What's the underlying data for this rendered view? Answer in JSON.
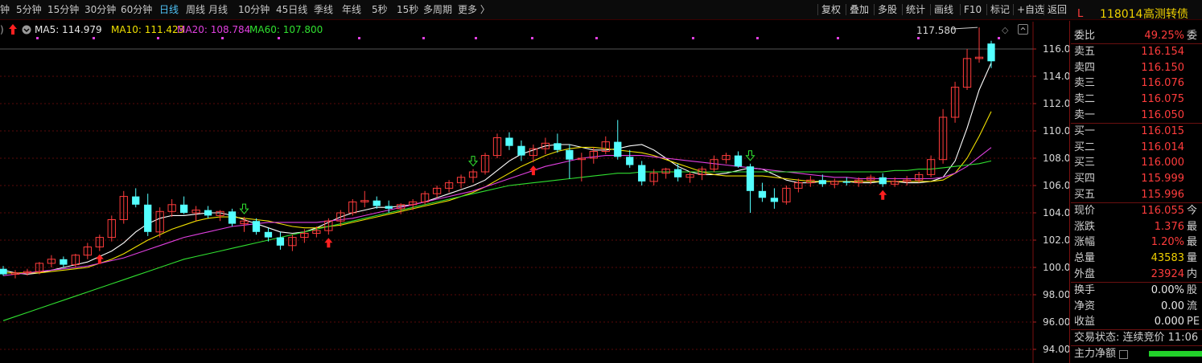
{
  "toolbar": {
    "timeframes": [
      "钟",
      "5分钟",
      "15分钟",
      "30分钟",
      "60分钟",
      "日线",
      "周线",
      "月线",
      "10分钟",
      "45日线",
      "季线",
      "年线",
      "5秒",
      "15秒",
      "多周期",
      "更多 〉"
    ],
    "active_timeframe": "日线",
    "right_buttons": [
      "复权",
      "叠加",
      "多股",
      "统计",
      "画线",
      "F10",
      "标记",
      "+自选",
      "返回"
    ]
  },
  "quote_header": {
    "market_flag": "L",
    "code": "118014",
    "name": "高测转债"
  },
  "ma_legend": {
    "prefix": ")",
    "ma5": "MA5: 114.979",
    "ma10": "MA10: 111.423",
    "ma20": "MA20: 108.784",
    "ma60": "MA60: 107.800"
  },
  "chart": {
    "y_axis": {
      "min": 93,
      "max": 118,
      "ticks": [
        "116.0",
        "114.0",
        "112.0",
        "110.0",
        "108.0",
        "106.0",
        "104.0",
        "102.0",
        "100.0",
        "98.00",
        "96.00",
        "94.00"
      ],
      "tick_values": [
        116,
        114,
        112,
        110,
        108,
        106,
        104,
        102,
        100,
        98,
        96,
        94
      ]
    },
    "crosshair_value": 116.0,
    "peak_label": "117.580",
    "colors": {
      "up": "#ff3c3c",
      "down": "#54ffff",
      "ma5": "#ffffff",
      "ma10": "#f0e000",
      "ma20": "#e040e0",
      "ma60": "#30e030",
      "grid": "#5a0a0a"
    }
  },
  "chart_data": {
    "type": "candlestick",
    "y_range": [
      93,
      118
    ],
    "series": [
      {
        "name": "MA5",
        "values": [
          99.8,
          99.6,
          99.5,
          99.6,
          99.8,
          100.0,
          100.2,
          100.4,
          100.8,
          101.2,
          101.8,
          102.6,
          103.2,
          103.6,
          103.8,
          103.8,
          103.9,
          104.0,
          104.0,
          103.8,
          103.5,
          103.2,
          102.9,
          102.6,
          102.5,
          102.6,
          102.9,
          103.3,
          103.7,
          104.0,
          104.2,
          104.4,
          104.4,
          104.5,
          104.6,
          104.8,
          105.1,
          105.4,
          105.7,
          106.0,
          106.4,
          107.1,
          107.8,
          108.3,
          108.6,
          108.9,
          109.0,
          109.0,
          108.8,
          108.6,
          108.6,
          108.7,
          108.9,
          109.0,
          108.6,
          108.0,
          107.4,
          107.0,
          106.8,
          106.8,
          106.9,
          107.1,
          107.3,
          107.2,
          106.8,
          106.4,
          106.2,
          106.2,
          106.3,
          106.3,
          106.3,
          106.2,
          106.2,
          106.3,
          106.3,
          106.2,
          106.2,
          106.3,
          106.6,
          107.8,
          110.2,
          113.0,
          114.98
        ]
      },
      {
        "name": "MA10",
        "values": [
          99.6,
          99.6,
          99.6,
          99.6,
          99.7,
          99.8,
          99.9,
          100.0,
          100.3,
          100.6,
          101.0,
          101.5,
          102.0,
          102.4,
          102.8,
          103.1,
          103.4,
          103.6,
          103.7,
          103.7,
          103.6,
          103.5,
          103.4,
          103.2,
          103.0,
          102.9,
          102.9,
          103.0,
          103.1,
          103.3,
          103.5,
          103.7,
          103.9,
          104.1,
          104.3,
          104.5,
          104.7,
          104.9,
          105.2,
          105.5,
          105.9,
          106.4,
          106.9,
          107.4,
          107.8,
          108.2,
          108.5,
          108.7,
          108.8,
          108.8,
          108.7,
          108.6,
          108.5,
          108.4,
          108.2,
          107.9,
          107.6,
          107.3,
          107.0,
          106.8,
          106.7,
          106.7,
          106.7,
          106.7,
          106.6,
          106.5,
          106.4,
          106.3,
          106.3,
          106.3,
          106.3,
          106.3,
          106.3,
          106.3,
          106.3,
          106.3,
          106.3,
          106.3,
          106.4,
          106.9,
          108.0,
          109.6,
          111.42
        ]
      },
      {
        "name": "MA20",
        "values": [
          99.4,
          99.5,
          99.6,
          99.7,
          99.8,
          99.9,
          100.0,
          100.1,
          100.3,
          100.5,
          100.7,
          101.0,
          101.3,
          101.6,
          101.9,
          102.2,
          102.4,
          102.6,
          102.8,
          103.0,
          103.1,
          103.2,
          103.3,
          103.3,
          103.3,
          103.3,
          103.3,
          103.4,
          103.5,
          103.6,
          103.8,
          104.0,
          104.2,
          104.4,
          104.6,
          104.8,
          105.0,
          105.2,
          105.4,
          105.6,
          105.9,
          106.2,
          106.5,
          106.8,
          107.1,
          107.4,
          107.6,
          107.8,
          108.0,
          108.1,
          108.2,
          108.2,
          108.2,
          108.2,
          108.1,
          108.0,
          107.9,
          107.8,
          107.7,
          107.6,
          107.5,
          107.4,
          107.3,
          107.2,
          107.1,
          107.0,
          106.9,
          106.8,
          106.7,
          106.6,
          106.6,
          106.5,
          106.5,
          106.5,
          106.5,
          106.5,
          106.5,
          106.5,
          106.6,
          106.9,
          107.4,
          108.1,
          108.78
        ]
      },
      {
        "name": "MA60",
        "values": [
          96.1,
          96.4,
          96.7,
          97.0,
          97.3,
          97.6,
          97.9,
          98.2,
          98.5,
          98.8,
          99.1,
          99.4,
          99.7,
          100.0,
          100.3,
          100.6,
          100.8,
          101.0,
          101.2,
          101.4,
          101.6,
          101.8,
          102.0,
          102.2,
          102.4,
          102.6,
          102.8,
          103.0,
          103.2,
          103.4,
          103.6,
          103.8,
          104.0,
          104.2,
          104.4,
          104.6,
          104.8,
          105.0,
          105.2,
          105.4,
          105.6,
          105.8,
          106.0,
          106.1,
          106.2,
          106.3,
          106.4,
          106.5,
          106.6,
          106.7,
          106.8,
          106.9,
          106.9,
          107.0,
          107.0,
          107.0,
          107.0,
          107.0,
          107.0,
          107.0,
          107.0,
          107.0,
          107.0,
          107.0,
          107.0,
          107.0,
          107.0,
          107.0,
          107.0,
          107.0,
          107.0,
          107.0,
          107.0,
          107.0,
          107.1,
          107.1,
          107.2,
          107.2,
          107.3,
          107.4,
          107.5,
          107.6,
          107.8
        ]
      }
    ],
    "candles": [
      [
        99.9,
        100.1,
        99.4,
        99.5
      ],
      [
        99.5,
        99.8,
        99.2,
        99.6
      ],
      [
        99.6,
        99.9,
        99.4,
        99.7
      ],
      [
        99.7,
        100.4,
        99.5,
        100.3
      ],
      [
        100.3,
        100.9,
        100.0,
        100.6
      ],
      [
        100.6,
        100.8,
        100.0,
        100.2
      ],
      [
        100.2,
        101.0,
        100.0,
        100.9
      ],
      [
        100.9,
        101.8,
        100.6,
        101.5
      ],
      [
        101.5,
        102.4,
        101.2,
        102.2
      ],
      [
        102.2,
        103.8,
        101.9,
        103.5
      ],
      [
        103.5,
        105.6,
        103.2,
        105.2
      ],
      [
        105.2,
        105.8,
        104.4,
        104.6
      ],
      [
        104.6,
        105.4,
        102.3,
        102.6
      ],
      [
        102.6,
        104.4,
        102.2,
        104.1
      ],
      [
        104.1,
        105.0,
        103.7,
        104.6
      ],
      [
        104.6,
        105.2,
        103.9,
        104.0
      ],
      [
        104.0,
        104.5,
        103.4,
        104.2
      ],
      [
        104.2,
        104.5,
        103.6,
        103.8
      ],
      [
        103.8,
        104.2,
        103.4,
        104.1
      ],
      [
        104.1,
        104.3,
        103.0,
        103.2
      ],
      [
        103.2,
        103.7,
        102.6,
        103.4
      ],
      [
        103.4,
        103.6,
        102.4,
        102.6
      ],
      [
        102.6,
        102.9,
        101.9,
        102.2
      ],
      [
        102.2,
        102.6,
        101.3,
        101.6
      ],
      [
        101.6,
        102.4,
        101.2,
        102.2
      ],
      [
        102.2,
        102.8,
        101.8,
        102.5
      ],
      [
        102.5,
        103.0,
        102.2,
        102.7
      ],
      [
        102.7,
        103.6,
        102.4,
        103.4
      ],
      [
        103.4,
        104.2,
        103.0,
        104.0
      ],
      [
        104.0,
        105.0,
        103.8,
        104.8
      ],
      [
        104.8,
        105.6,
        104.4,
        104.9
      ],
      [
        104.9,
        105.2,
        104.3,
        104.5
      ],
      [
        104.5,
        104.9,
        104.0,
        104.3
      ],
      [
        104.3,
        104.7,
        103.9,
        104.6
      ],
      [
        104.6,
        105.0,
        104.2,
        104.8
      ],
      [
        104.8,
        105.6,
        104.6,
        105.4
      ],
      [
        105.4,
        106.0,
        105.1,
        105.8
      ],
      [
        105.8,
        106.4,
        105.5,
        106.2
      ],
      [
        106.2,
        106.8,
        105.8,
        106.6
      ],
      [
        106.6,
        107.2,
        106.2,
        107.0
      ],
      [
        107.0,
        108.4,
        106.8,
        108.2
      ],
      [
        108.2,
        109.8,
        108.0,
        109.5
      ],
      [
        109.5,
        109.9,
        108.6,
        108.9
      ],
      [
        108.9,
        109.3,
        107.8,
        108.2
      ],
      [
        108.2,
        109.0,
        107.7,
        108.7
      ],
      [
        108.7,
        109.5,
        108.3,
        109.1
      ],
      [
        109.1,
        109.8,
        108.4,
        108.6
      ],
      [
        108.6,
        109.0,
        106.5,
        107.9
      ],
      [
        107.9,
        108.4,
        106.3,
        108.0
      ],
      [
        108.0,
        108.8,
        107.6,
        108.5
      ],
      [
        108.5,
        109.6,
        108.3,
        109.2
      ],
      [
        109.2,
        110.8,
        107.9,
        108.1
      ],
      [
        108.1,
        108.6,
        107.3,
        107.5
      ],
      [
        107.5,
        107.8,
        106.0,
        106.3
      ],
      [
        106.3,
        107.2,
        106.0,
        106.9
      ],
      [
        106.9,
        107.3,
        106.5,
        107.2
      ],
      [
        107.2,
        107.6,
        106.3,
        106.6
      ],
      [
        106.6,
        107.0,
        106.2,
        106.8
      ],
      [
        106.8,
        107.4,
        106.4,
        107.2
      ],
      [
        107.2,
        108.2,
        107.0,
        107.9
      ],
      [
        107.9,
        108.4,
        107.6,
        108.2
      ],
      [
        108.2,
        108.5,
        107.3,
        107.4
      ],
      [
        107.4,
        107.6,
        104.0,
        105.6
      ],
      [
        105.6,
        106.2,
        104.8,
        105.1
      ],
      [
        105.1,
        105.8,
        104.3,
        104.8
      ],
      [
        104.8,
        106.0,
        104.6,
        105.8
      ],
      [
        105.8,
        106.5,
        105.5,
        106.2
      ],
      [
        106.2,
        106.7,
        105.9,
        106.4
      ],
      [
        106.4,
        106.8,
        105.9,
        106.1
      ],
      [
        106.1,
        106.5,
        105.8,
        106.3
      ],
      [
        106.3,
        106.6,
        106.0,
        106.2
      ],
      [
        106.2,
        106.6,
        105.9,
        106.4
      ],
      [
        106.4,
        106.8,
        106.1,
        106.6
      ],
      [
        106.6,
        106.9,
        105.9,
        106.1
      ],
      [
        106.1,
        106.6,
        105.9,
        106.3
      ],
      [
        106.3,
        106.7,
        106.0,
        106.4
      ],
      [
        106.4,
        107.0,
        106.2,
        106.8
      ],
      [
        106.8,
        108.2,
        106.6,
        107.9
      ],
      [
        107.9,
        111.6,
        107.6,
        111.0
      ],
      [
        111.0,
        113.6,
        110.6,
        113.2
      ],
      [
        113.2,
        116.0,
        113.0,
        115.3
      ],
      [
        115.3,
        117.58,
        115.0,
        115.4
      ],
      [
        116.4,
        116.6,
        114.6,
        115.1
      ]
    ]
  },
  "side_panel": {
    "weibi": {
      "label": "委比",
      "value": "49.25%",
      "extra": "委"
    },
    "asks": [
      {
        "label": "卖五",
        "value": "116.154"
      },
      {
        "label": "卖四",
        "value": "116.150"
      },
      {
        "label": "卖三",
        "value": "116.076"
      },
      {
        "label": "卖二",
        "value": "116.075"
      },
      {
        "label": "卖一",
        "value": "116.050"
      }
    ],
    "bids": [
      {
        "label": "买一",
        "value": "116.015"
      },
      {
        "label": "买二",
        "value": "116.014"
      },
      {
        "label": "买三",
        "value": "116.000"
      },
      {
        "label": "买四",
        "value": "115.999"
      },
      {
        "label": "买五",
        "value": "115.996"
      }
    ],
    "stats": [
      {
        "label": "现价",
        "value": "116.055",
        "extra": "今"
      },
      {
        "label": "涨跌",
        "value": "1.376",
        "extra": "最"
      },
      {
        "label": "涨幅",
        "value": "1.20%",
        "extra": "最"
      },
      {
        "label": "总量",
        "value": "43583",
        "extra": "量"
      },
      {
        "label": "外盘",
        "value": "23924",
        "extra": "内"
      }
    ],
    "stats2": [
      {
        "label": "换手",
        "value": "0.00%",
        "extra": "股"
      },
      {
        "label": "净资",
        "value": "0.00",
        "extra": "流"
      },
      {
        "label": "收益",
        "value": "0.000",
        "extra": "PE"
      }
    ],
    "trade_status": "交易状态: 连续竞价 11:06",
    "main_flow_label": "主力净额"
  }
}
